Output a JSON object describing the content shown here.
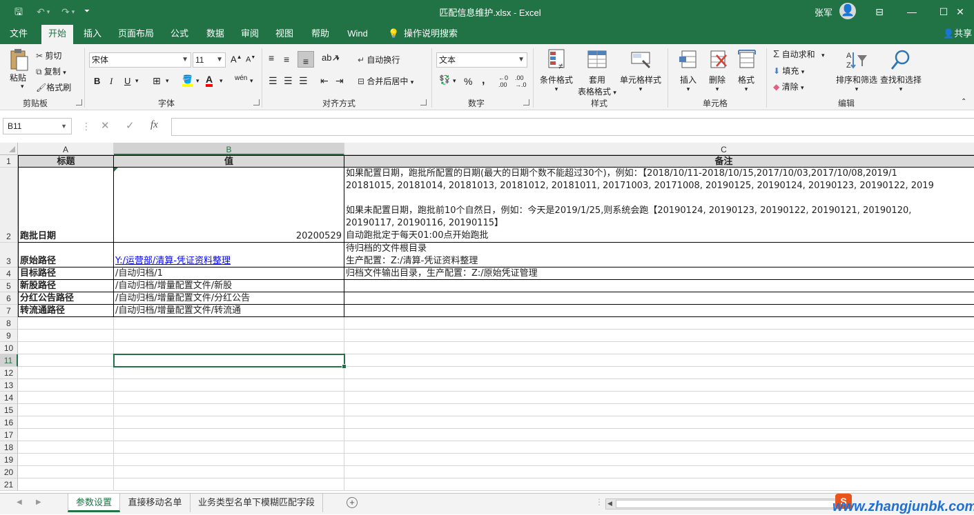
{
  "titlebar": {
    "title": "匹配信息维护.xlsx  -  Excel",
    "user": "张军",
    "minimize": "—",
    "restore": "☐",
    "close": "✕",
    "ribbon_display": "⊟"
  },
  "tabs": [
    "文件",
    "开始",
    "插入",
    "页面布局",
    "公式",
    "数据",
    "审阅",
    "视图",
    "帮助",
    "Wind",
    "操作说明搜索"
  ],
  "share": "共享",
  "ribbon": {
    "clipboard": {
      "paste": "粘贴",
      "cut": "剪切",
      "copy": "复制",
      "format_painter": "格式刷",
      "label": "剪贴板"
    },
    "font": {
      "name": "宋体",
      "size": "11",
      "grow": "A",
      "shrink": "A",
      "bold": "B",
      "italic": "I",
      "underline": "U",
      "wen": "wén",
      "label": "字体"
    },
    "alignment": {
      "wrap": "自动换行",
      "merge": "合并后居中",
      "label": "对齐方式"
    },
    "number": {
      "format": "文本",
      "percent": "%",
      "comma": ",",
      "label": "数字"
    },
    "styles": {
      "conditional": "条件格式",
      "table1": "套用",
      "table2": "表格格式",
      "cell_styles": "单元格样式",
      "label": "样式"
    },
    "cells": {
      "insert": "插入",
      "delete": "删除",
      "format": "格式",
      "label": "单元格"
    },
    "editing": {
      "autosum": "自动求和",
      "fill": "填充",
      "clear": "清除",
      "sort": "排序和筛选",
      "find": "查找和选择",
      "label": "编辑"
    }
  },
  "formula_bar": {
    "namebox": "B11",
    "cancel": "✕",
    "enter": "✓",
    "fx": "fx",
    "content": ""
  },
  "columns": [
    "A",
    "B",
    "C"
  ],
  "rows": [
    "1",
    "2",
    "3",
    "4",
    "5",
    "6",
    "7",
    "8",
    "9",
    "10",
    "11",
    "12",
    "13",
    "14",
    "15",
    "16",
    "17",
    "18",
    "19",
    "20",
    "21"
  ],
  "cells": {
    "a1": "标题",
    "b1": "值",
    "c1": "备注",
    "a2": "跑批日期",
    "b2": "20200529",
    "c2_line1": "如果配置日期，跑批所配置的日期(最大的日期个数不能超过30个)，例如：【2018/10/11-2018/10/15,2017/10/03,2017/10/08,2019/1",
    "c2_line2": "20181015, 20181014, 20181013, 20181012, 20181011, 20171003, 20171008, 20190125, 20190124, 20190123, 20190122, 2019",
    "c2_line3": "如果未配置日期，跑批前10个自然日，例如：今天是2019/1/25,则系统会跑【20190124, 20190123, 20190122, 20190121, 20190120,",
    "c2_line4": "20190117, 20190116, 20190115】",
    "c2_line5": "自动跑批定于每天01:00点开始跑批",
    "a3": "原始路径",
    "b3": "Y:/运营部/清算-凭证资料整理",
    "c3_line1": "待归档的文件根目录",
    "c3_line2": "生产配置：Z:/清算-凭证资料整理",
    "a4": "目标路径",
    "b4": "/自动归档/1",
    "c4": "归档文件输出目录，生产配置：Z:/原始凭证管理",
    "a5": "新股路径",
    "b5": "/自动归档/增量配置文件/新股",
    "a6": "分红公告路径",
    "b6": "/自动归档/增量配置文件/分红公告",
    "a7": "转流通路径",
    "b7": "/自动归档/增量配置文件/转流通"
  },
  "sheets": [
    "参数设置",
    "直接移动名单",
    "业务类型名单下模糊匹配字段"
  ],
  "watermark": "www.zhangjunbk.com",
  "colors": {
    "accent": "#217346",
    "header_fill": "#d9d9d9",
    "link": "#0000ff"
  }
}
